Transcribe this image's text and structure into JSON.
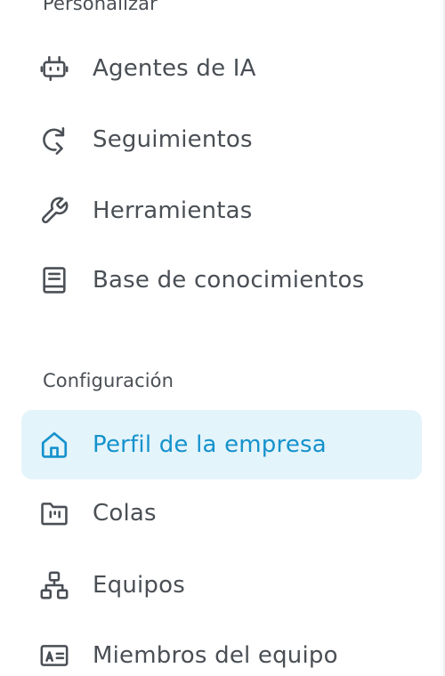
{
  "sections": {
    "personalizar": "Personalizar",
    "configuracion": "Configuración"
  },
  "items": {
    "agentes": {
      "label": "Agentes de IA",
      "icon": "robot-icon"
    },
    "seguimientos": {
      "label": "Seguimientos",
      "icon": "follow-up-arrow-icon"
    },
    "herramientas": {
      "label": "Herramientas",
      "icon": "wrench-icon"
    },
    "base": {
      "label": "Base de conocimientos",
      "icon": "book-icon"
    },
    "perfil": {
      "label": "Perfil de la empresa",
      "icon": "home-icon",
      "active": true
    },
    "colas": {
      "label": "Colas",
      "icon": "queue-folder-icon"
    },
    "equipos": {
      "label": "Equipos",
      "icon": "org-chart-icon"
    },
    "miembros": {
      "label": "Miembros del equipo",
      "icon": "id-card-icon"
    }
  },
  "colors": {
    "text": "#4a4f55",
    "active_text": "#1592cc",
    "active_background": "#e4f4fb"
  }
}
